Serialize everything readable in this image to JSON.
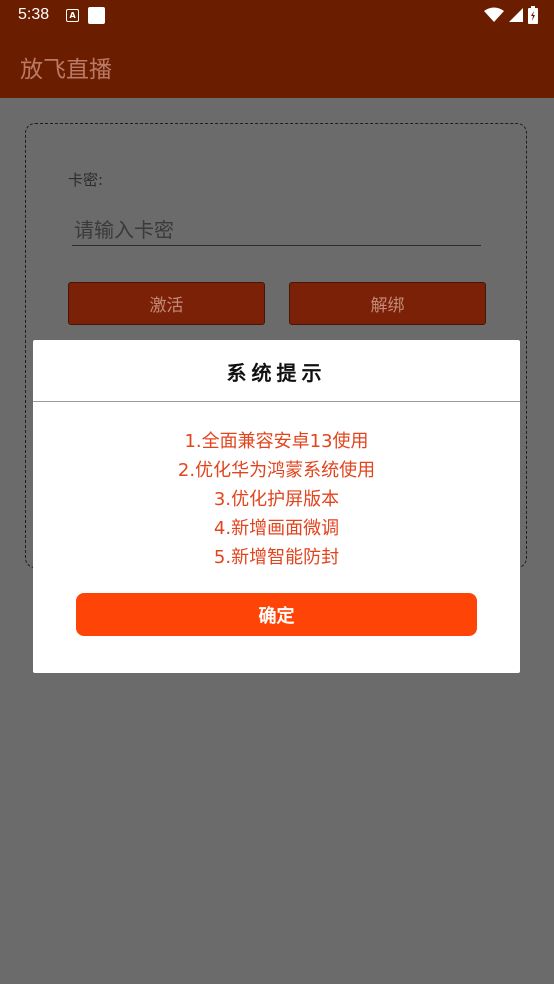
{
  "status_bar": {
    "time": "5:38",
    "notification_icon_letter": "A",
    "icons": [
      "wifi-icon",
      "signal-icon",
      "battery-icon"
    ]
  },
  "app_bar": {
    "title": "放飞直播"
  },
  "form": {
    "key_label": "卡密:",
    "key_input": {
      "value": "",
      "placeholder": "请输入卡密"
    },
    "activate_label": "激活",
    "unbind_label": "解绑"
  },
  "dialog": {
    "title": "系统提示",
    "lines": [
      "1.全面兼容安卓13使用",
      "2.优化华为鸿蒙系统使用",
      "3.优化护屏版本",
      "4.新增画面微调",
      "5.新增智能防封"
    ],
    "ok_label": "确定"
  },
  "colors": {
    "app_bar": "#6b1d00",
    "overlay": "#6b6b6b",
    "dialog_text": "#e2441e",
    "ok_button": "#ff4407"
  }
}
